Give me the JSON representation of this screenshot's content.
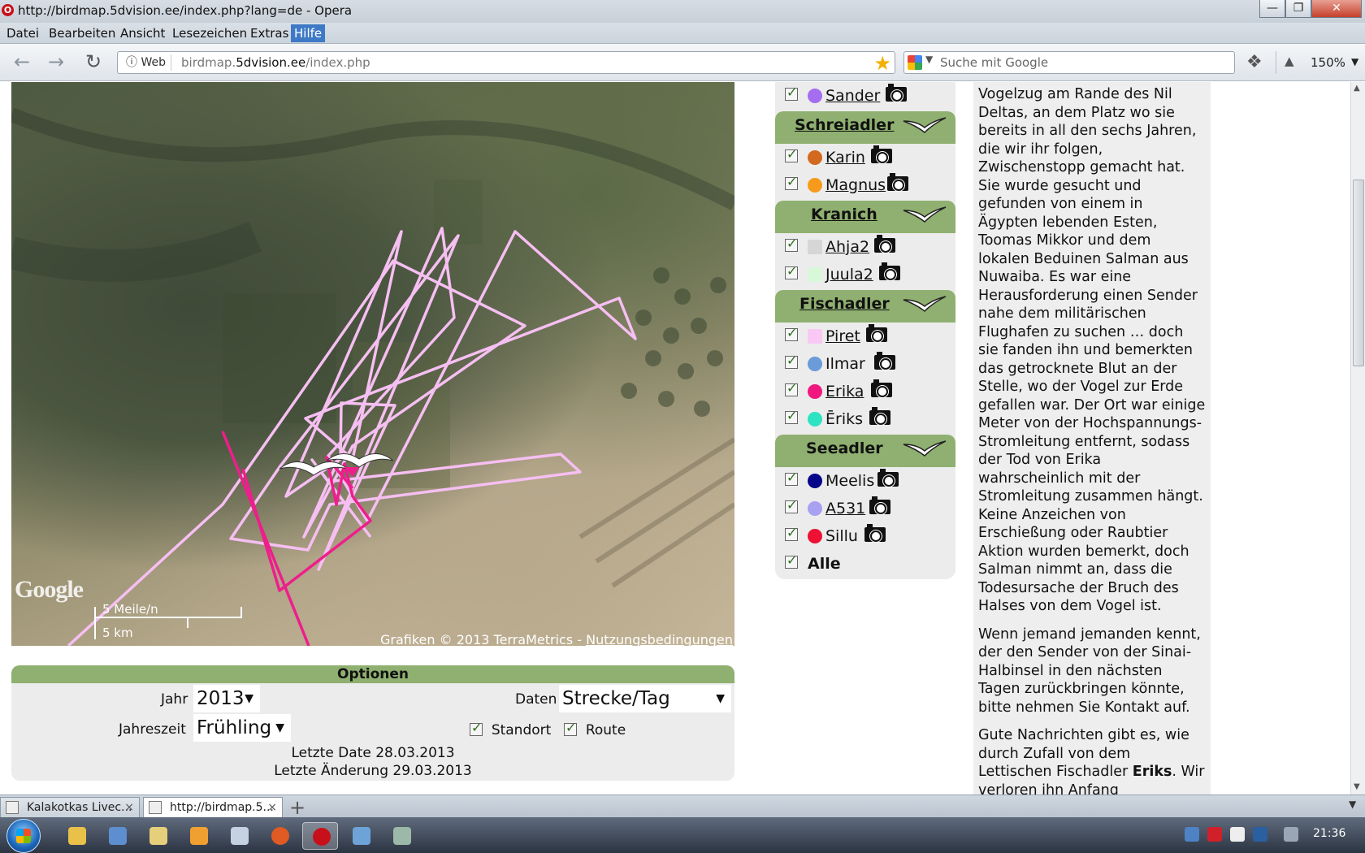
{
  "window": {
    "title": "http://birdmap.5dvision.ee/index.php?lang=de - Opera",
    "controls": {
      "minimize": "—",
      "maximize": "❐",
      "close": "✕"
    }
  },
  "menu": [
    "Datei",
    "Bearbeiten",
    "Ansicht",
    "Lesezeichen",
    "Extras",
    "Hilfe"
  ],
  "address": {
    "badge": "Web",
    "url_prefix": "birdmap.",
    "url_domain": "5dvision.ee",
    "url_path": "/index.php",
    "search_placeholder": "Suche mit Google",
    "zoom": "150%"
  },
  "map": {
    "scale_top": "5 Meile/n",
    "scale_bottom": "5 km",
    "copyright": "Grafiken © 2013 TerraMetrics - ",
    "terms_link": "Nutzungsbedingungen",
    "logo": "Google",
    "track_colors": {
      "piret": "#f6bff2",
      "erika": "#ee1e8c"
    }
  },
  "options": {
    "title": "Optionen",
    "year_label": "Jahr",
    "year_value": "2013",
    "data_label": "Daten",
    "data_value": "Strecke/Tag",
    "season_label": "Jahreszeit",
    "season_value": "Frühling",
    "location_label": "Standort",
    "route_label": "Route",
    "last_date": "Letzte Date 28.03.2013",
    "last_change": "Letzte Änderung 29.03.2013"
  },
  "birds": {
    "first": {
      "name": "Sander",
      "color": "#a56df0"
    },
    "species": [
      {
        "name": "Schreiadler",
        "birds": [
          {
            "name": "Karin",
            "color": "#d2691e",
            "link": true
          },
          {
            "name": "Magnus",
            "color": "#f59a1b",
            "link": true
          }
        ]
      },
      {
        "name": "Kranich",
        "birds": [
          {
            "name": "Ahja2",
            "color": "#d6d6d6",
            "link": true
          },
          {
            "name": "Juula2",
            "color": "#d9f7d9",
            "link": true
          }
        ]
      },
      {
        "name": "Fischadler",
        "birds": [
          {
            "name": "Piret",
            "color": "#f9c8f4",
            "link": true
          },
          {
            "name": "Ilmar",
            "color": "#6b9bd8",
            "link": false
          },
          {
            "name": "Erika",
            "color": "#f0187e",
            "link": true
          },
          {
            "name": "Ēriks",
            "color": "#2ee3c2",
            "link": false
          }
        ]
      },
      {
        "name": "Seeadler",
        "birds": [
          {
            "name": "Meelis",
            "color": "#06068a",
            "link": false
          },
          {
            "name": "A531",
            "color": "#a8a0f0",
            "link": true
          },
          {
            "name": "Sillu",
            "color": "#ee1133",
            "link": false
          }
        ]
      }
    ],
    "all_label": "Alle"
  },
  "story": {
    "p1": "Vogelzug am Rande des Nil Deltas, an dem Platz wo sie bereits in all den sechs Jahren, die wir ihr folgen, Zwischenstopp gemacht hat. Sie wurde gesucht und gefunden von einem in Ägypten lebenden Esten, Toomas Mikkor und dem lokalen Beduinen Salman aus Nuwaiba. Es war eine Herausforderung einen Sender nahe dem militärischen Flughafen zu suchen … doch sie fanden ihn und bemerkten das getrocknete Blut an der Stelle, wo der Vogel zur Erde gefallen war. Der Ort war einige Meter von der Hochspannungs-Stromleitung entfernt, sodass der Tod von Erika wahrscheinlich mit der Stromleitung zusammen hängt. Keine Anzeichen von Erschießung oder Raubtier Aktion wurden bemerkt, doch Salman nimmt an, dass die Todesursache der Bruch des Halses von dem Vogel ist.",
    "p2": "Wenn jemand jemanden kennt, der den Sender von der Sinai-Halbinsel in den nächsten Tagen zurückbringen könnte, bitte nehmen Sie Kontakt auf.",
    "p3_before": "Gute Nachrichten gibt es, wie durch Zufall von dem Lettischen Fischadler ",
    "p3_bold": "Eriks",
    "p3_after": ". Wir verloren ihn Anfang"
  },
  "tabs": [
    {
      "label": "Kalakotkas Livec...",
      "close": "×"
    },
    {
      "label": "http://birdmap.5...",
      "close": "×"
    }
  ],
  "taskbar": {
    "clock": "21:36"
  }
}
